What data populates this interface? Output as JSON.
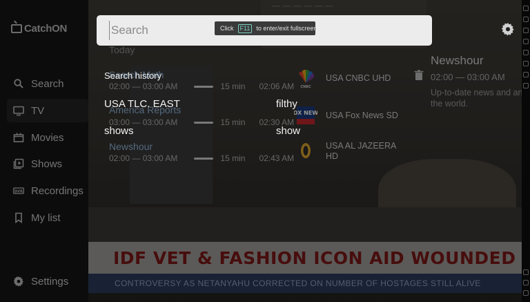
{
  "app": {
    "logo_text": "CatchON"
  },
  "sidebar": {
    "items": [
      {
        "label": "Search",
        "icon": "search-icon"
      },
      {
        "label": "TV",
        "icon": "tv-icon",
        "active": true
      },
      {
        "label": "Movies",
        "icon": "movies-icon"
      },
      {
        "label": "Shows",
        "icon": "shows-icon"
      },
      {
        "label": "Recordings",
        "icon": "dvr-icon",
        "icon_text": "DVR"
      },
      {
        "label": "My list",
        "icon": "bookmark-icon"
      },
      {
        "label": "Settings",
        "icon": "gear-icon"
      }
    ]
  },
  "search": {
    "placeholder": "Search",
    "value": "",
    "fullscreen_hint": {
      "before": "Click",
      "key": "F11",
      "after": "to enter/exit fullscreen"
    },
    "history_title": "Search history",
    "history": [
      "USA TLC. EAST",
      "filthy",
      "shows",
      "show"
    ]
  },
  "guide": {
    "rows": [
      {
        "title": "Today",
        "time": "",
        "duration": "",
        "ended": ""
      },
      {
        "title": "Search Math",
        "time": "02:00 — 03:00 AM",
        "duration": "15 min",
        "ended": "02:06 AM"
      },
      {
        "title": "America Reports",
        "time": "03:00 — 03:00 AM",
        "duration": "15 min",
        "ended": "02:30 AM"
      },
      {
        "title": "Newshour",
        "time": "02:00 — 03:00 AM",
        "duration": "15 min",
        "ended": "02:43 AM"
      }
    ],
    "channels": [
      {
        "name": "USA CNBC UHD",
        "logo": "cnbc-peacock-logo",
        "logo_text": "CNBC"
      },
      {
        "name": "USA Fox News SD",
        "logo": "fox-news-logo",
        "logo_text": "FOX NEWS"
      },
      {
        "name": "USA AL JAZEERA HD",
        "logo": "al-jazeera-logo",
        "logo_text": ""
      }
    ],
    "detail": {
      "title": "Newshour",
      "time": "02:00 — 03:00 AM",
      "description": "Up-to-date news and an the world."
    }
  },
  "video": {
    "headline": "IDF VET & FASHION ICON AID WOUNDED FEMALE SOLD",
    "ticker": "CONTROVERSY AS NETANYAHU CORRECTED ON NUMBER OF HOSTAGES STILL ALIVE",
    "top_text": "— — — — — —"
  },
  "colors": {
    "accent_link": "#8fb4d8",
    "search_box": "#ececec",
    "headline_text": "#7a1818",
    "ticker_bg": "#2c3b5a"
  }
}
